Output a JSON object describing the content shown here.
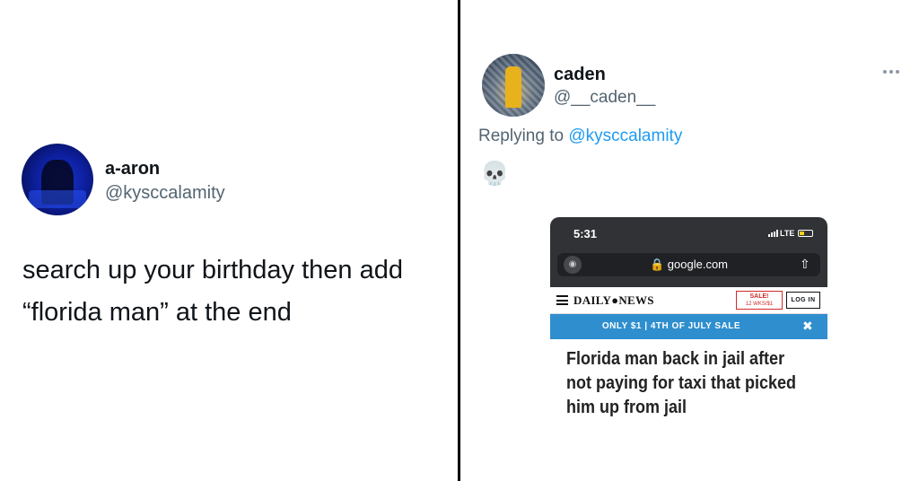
{
  "left_tweet": {
    "name": "a-aron",
    "handle": "@kysccalamity",
    "text_line1": "search up your birthday then add",
    "text_line2": "“florida man” at the end"
  },
  "right_tweet": {
    "name": "caden",
    "handle": "@__caden__",
    "replying_prefix": "Replying to ",
    "replying_mention": "@kysccalamity",
    "emoji": "💀",
    "screenshot": {
      "time": "5:31",
      "network": "LTE",
      "url": "google.com",
      "logo": "DAILY●NEWS",
      "sale_line1": "SALE!",
      "sale_line2": "12 WKS/$1",
      "login": "LOG IN",
      "promo": "ONLY $1 | 4TH OF JULY SALE",
      "close": "✖",
      "headline": "Florida man back in jail after not paying for taxi that picked him up from jail"
    }
  },
  "icons": {
    "more": "more-icon",
    "incognito": "incognito-icon",
    "lock": "lock-icon",
    "share": "share-icon",
    "hamburger": "hamburger-menu-icon"
  },
  "colors": {
    "link": "#1d9bf0",
    "secondary_text": "#536471",
    "promo_bar": "#2f8fce",
    "sale_red": "#d12a2a"
  }
}
